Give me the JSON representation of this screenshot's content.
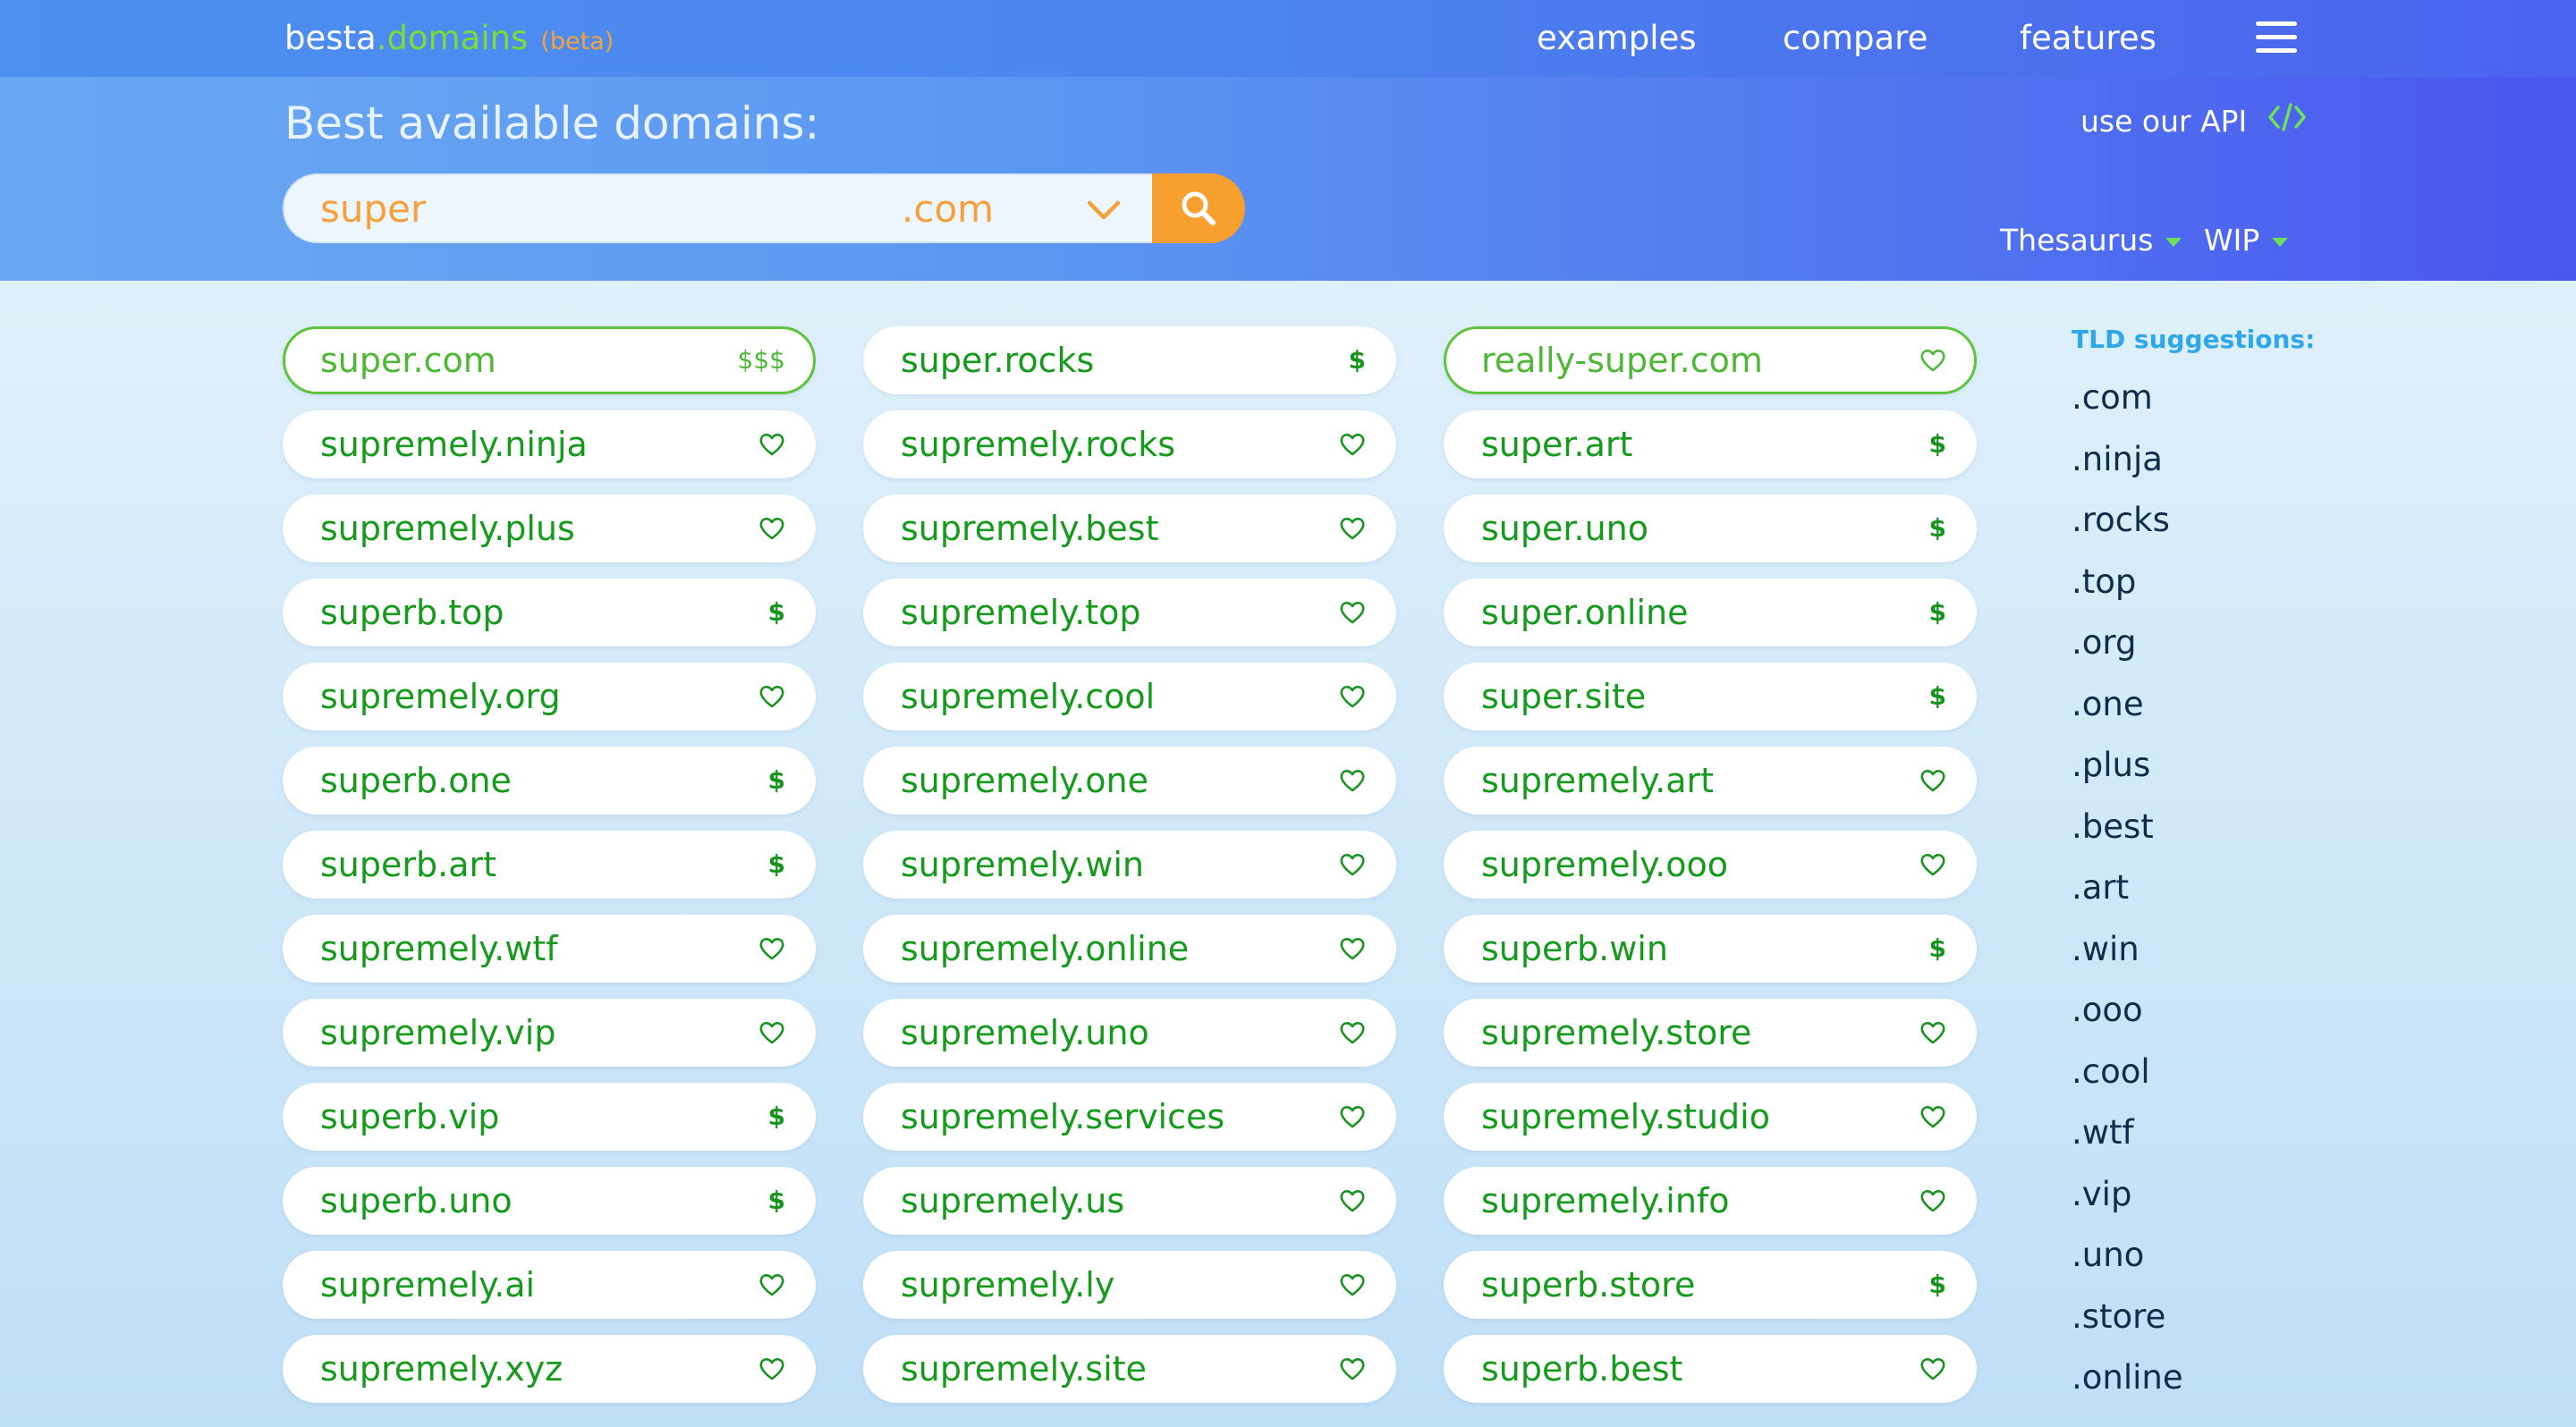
{
  "brand": {
    "part1": "besta",
    "part2": ".domains",
    "tag": "(beta)"
  },
  "nav": {
    "examples": "examples",
    "compare": "compare",
    "features": "features",
    "menu_icon": "hamburger-menu-icon"
  },
  "hero": {
    "title": "Best available domains:",
    "api_link": "use our API",
    "api_icon": "code-icon"
  },
  "search": {
    "query": "super",
    "tld": ".com",
    "button_icon": "search-icon"
  },
  "filters": {
    "mode": "Thesaurus",
    "status": "WIP"
  },
  "colors": {
    "accent": "#f7a02f",
    "domain_text": "#159a1c",
    "highlight": "#5ec43b",
    "tld_title": "#2fa7e8"
  },
  "results": {
    "columns": [
      [
        {
          "name": "super.com",
          "tag": "$$$",
          "highlight": true
        },
        {
          "name": "supremely.ninja",
          "tag": "heart"
        },
        {
          "name": "supremely.plus",
          "tag": "heart"
        },
        {
          "name": "superb.top",
          "tag": "$"
        },
        {
          "name": "supremely.org",
          "tag": "heart"
        },
        {
          "name": "superb.one",
          "tag": "$"
        },
        {
          "name": "superb.art",
          "tag": "$"
        },
        {
          "name": "supremely.wtf",
          "tag": "heart"
        },
        {
          "name": "supremely.vip",
          "tag": "heart"
        },
        {
          "name": "superb.vip",
          "tag": "$"
        },
        {
          "name": "superb.uno",
          "tag": "$"
        },
        {
          "name": "supremely.ai",
          "tag": "heart"
        },
        {
          "name": "supremely.xyz",
          "tag": "heart"
        }
      ],
      [
        {
          "name": "super.rocks",
          "tag": "$"
        },
        {
          "name": "supremely.rocks",
          "tag": "heart"
        },
        {
          "name": "supremely.best",
          "tag": "heart"
        },
        {
          "name": "supremely.top",
          "tag": "heart"
        },
        {
          "name": "supremely.cool",
          "tag": "heart"
        },
        {
          "name": "supremely.one",
          "tag": "heart"
        },
        {
          "name": "supremely.win",
          "tag": "heart"
        },
        {
          "name": "supremely.online",
          "tag": "heart"
        },
        {
          "name": "supremely.uno",
          "tag": "heart"
        },
        {
          "name": "supremely.services",
          "tag": "heart"
        },
        {
          "name": "supremely.us",
          "tag": "heart"
        },
        {
          "name": "supremely.ly",
          "tag": "heart"
        },
        {
          "name": "supremely.site",
          "tag": "heart"
        }
      ],
      [
        {
          "name": "really-super.com",
          "tag": "heart",
          "highlight": true
        },
        {
          "name": "super.art",
          "tag": "$"
        },
        {
          "name": "super.uno",
          "tag": "$"
        },
        {
          "name": "super.online",
          "tag": "$"
        },
        {
          "name": "super.site",
          "tag": "$"
        },
        {
          "name": "supremely.art",
          "tag": "heart"
        },
        {
          "name": "supremely.ooo",
          "tag": "heart"
        },
        {
          "name": "superb.win",
          "tag": "$"
        },
        {
          "name": "supremely.store",
          "tag": "heart"
        },
        {
          "name": "supremely.studio",
          "tag": "heart"
        },
        {
          "name": "supremely.info",
          "tag": "heart"
        },
        {
          "name": "superb.store",
          "tag": "$"
        },
        {
          "name": "superb.best",
          "tag": "heart"
        }
      ]
    ]
  },
  "tld_suggestions": {
    "title": "TLD suggestions:",
    "items": [
      ".com",
      ".ninja",
      ".rocks",
      ".top",
      ".org",
      ".one",
      ".plus",
      ".best",
      ".art",
      ".win",
      ".ooo",
      ".cool",
      ".wtf",
      ".vip",
      ".uno",
      ".store",
      ".online"
    ]
  }
}
